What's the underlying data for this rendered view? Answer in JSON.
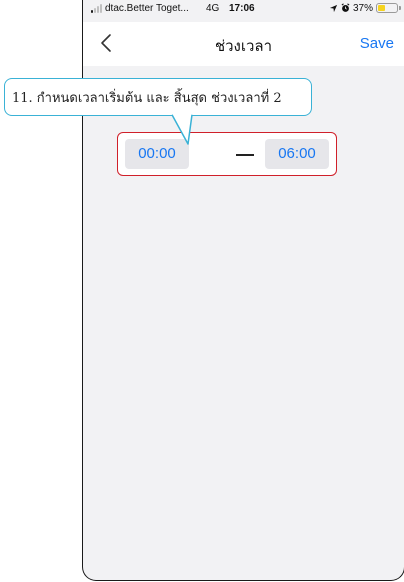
{
  "status_bar": {
    "carrier": "dtac.Better Toget...",
    "network": "4G",
    "time": "17:06",
    "battery_percent": "37%",
    "battery_level": 0.37,
    "battery_color": "#f5d31f",
    "icons": [
      "signal-icon",
      "location-icon",
      "alarm-icon",
      "battery-icon"
    ]
  },
  "nav": {
    "back_icon": "chevron-left-icon",
    "title": "ช่วงเวลา",
    "save_label": "Save"
  },
  "time_range": {
    "start": "00:00",
    "end": "06:00"
  },
  "annotation": {
    "text": "11. กำหนดเวลาเริ่มต้น และ สิ้นสุด ช่วงเวลาที่ 2"
  },
  "colors": {
    "accent": "#1877f2",
    "highlight_border": "#d0202a",
    "annotation_border": "#3ab2d6",
    "background": "#f2f2f4"
  }
}
